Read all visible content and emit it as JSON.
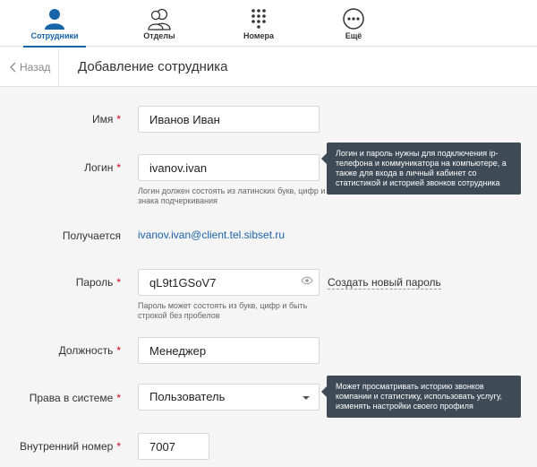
{
  "tabs": [
    {
      "label": "Сотрудники",
      "icon": "user-icon",
      "active": true
    },
    {
      "label": "Отделы",
      "icon": "users-icon",
      "active": false
    },
    {
      "label": "Номера",
      "icon": "dialpad-icon",
      "active": false
    },
    {
      "label": "Ещё",
      "icon": "more-icon",
      "active": false
    }
  ],
  "header": {
    "back_label": "Назад",
    "title": "Добавление сотрудника"
  },
  "form": {
    "name": {
      "label": "Имя",
      "value": "Иванов Иван"
    },
    "login": {
      "label": "Логин",
      "value": "ivanov.ivan",
      "hint": "Логин должен состоять из латинских букв, цифр и знака подчеркивания",
      "tooltip": "Логин и пароль нужны для подключения ip-телефона и коммуникатора на компьютере, а также для входа в личный кабинет со статистикой и историей звонков сотрудника"
    },
    "result": {
      "label": "Получается",
      "value": "ivanov.ivan@client.tel.sibset.ru"
    },
    "password": {
      "label": "Пароль",
      "value": "qL9t1GSoV7",
      "hint": "Пароль может состоять из букв, цифр и быть строкой без пробелов",
      "generate_label": "Создать новый пароль"
    },
    "position": {
      "label": "Должность",
      "value": "Менеджер"
    },
    "rights": {
      "label": "Права в системе",
      "value": "Пользователь",
      "tooltip": "Может просматривать историю звонков компании и статистику, использовать услугу, изменять настройки своего профиля"
    },
    "extension": {
      "label": "Внутренний номер",
      "value": "7007"
    }
  },
  "required_mark": "*",
  "colors": {
    "accent": "#1565a8",
    "required": "#d0021b",
    "tooltip_bg": "#3e4a56",
    "link": "#1a62a8"
  }
}
